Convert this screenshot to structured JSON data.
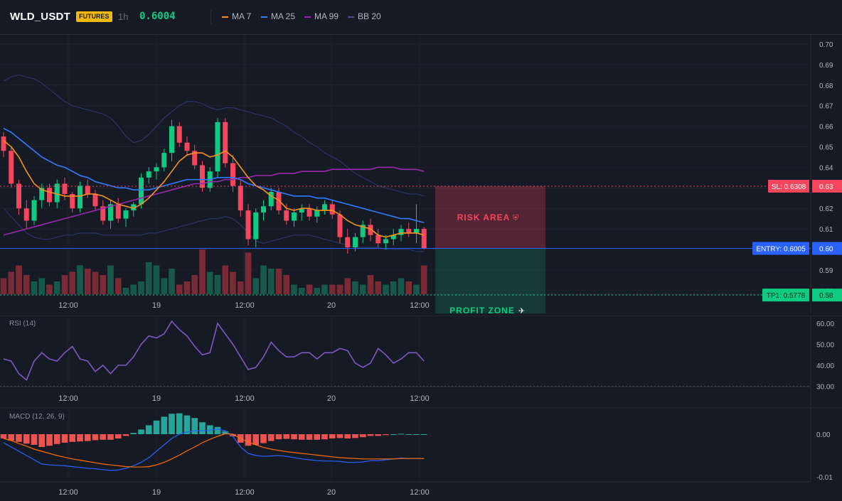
{
  "header": {
    "symbol": "WLD_USDT",
    "badge": "FUTURES",
    "timeframe": "1h",
    "price": "0.6004",
    "legend": [
      {
        "label": "MA 7",
        "color": "#f7931a"
      },
      {
        "label": "MA 25",
        "color": "#2f7dff"
      },
      {
        "label": "MA 99",
        "color": "#9c27b0"
      },
      {
        "label": "BB 20",
        "color": "#3a4f8c"
      }
    ]
  },
  "main_chart": {
    "y_ticks": [
      "0.70",
      "0.69",
      "0.68",
      "0.67",
      "0.66",
      "0.65",
      "0.64",
      "0.63",
      "0.62",
      "0.61",
      "0.60",
      "0.59",
      "0.58"
    ],
    "x_ticks": [
      "12:00",
      "19",
      "12:00",
      "20",
      "12:00"
    ],
    "sl_label": "SL: 0.6308",
    "sl_tag": "0.63",
    "entry_label": "ENTRY: 0.6005",
    "entry_tag": "0.60",
    "tp_label": "TP1: 0.5778",
    "tp_tag": "0.58",
    "risk_text": "RISK AREA",
    "profit_text": "PROFIT ZONE",
    "colors": {
      "up": "#0ecb81",
      "down": "#f6465d",
      "sl": "#f6465d",
      "entry": "#2962ff",
      "tp": "#0ecb81"
    }
  },
  "rsi": {
    "label": "RSI (14)",
    "y_ticks": [
      "60.00",
      "50.00",
      "40.00",
      "30.00"
    ],
    "x_ticks": [
      "12:00",
      "19",
      "12:00",
      "20",
      "12:00"
    ],
    "color": "#7e57c2"
  },
  "macd": {
    "label": "MACD (12, 26, 9)",
    "y_ticks": [
      "0.00",
      "-0.01"
    ],
    "x_ticks": [
      "12:00",
      "19",
      "12:00",
      "20",
      "12:00"
    ]
  },
  "chart_data": {
    "type": "candlestick",
    "interval": "1h",
    "ylim": [
      0.575,
      0.703
    ],
    "candles": [
      [
        0.655,
        0.657,
        0.645,
        0.648
      ],
      [
        0.648,
        0.65,
        0.63,
        0.632
      ],
      [
        0.632,
        0.634,
        0.617,
        0.62
      ],
      [
        0.62,
        0.624,
        0.61,
        0.614
      ],
      [
        0.614,
        0.626,
        0.612,
        0.624
      ],
      [
        0.624,
        0.632,
        0.62,
        0.63
      ],
      [
        0.63,
        0.632,
        0.621,
        0.623
      ],
      [
        0.623,
        0.634,
        0.62,
        0.632
      ],
      [
        0.632,
        0.635,
        0.624,
        0.627
      ],
      [
        0.627,
        0.628,
        0.618,
        0.62
      ],
      [
        0.62,
        0.633,
        0.618,
        0.631
      ],
      [
        0.631,
        0.634,
        0.625,
        0.627
      ],
      [
        0.627,
        0.629,
        0.619,
        0.621
      ],
      [
        0.621,
        0.624,
        0.612,
        0.614
      ],
      [
        0.614,
        0.624,
        0.61,
        0.622
      ],
      [
        0.622,
        0.625,
        0.613,
        0.615
      ],
      [
        0.615,
        0.62,
        0.611,
        0.619
      ],
      [
        0.619,
        0.623,
        0.616,
        0.622
      ],
      [
        0.622,
        0.637,
        0.62,
        0.635
      ],
      [
        0.635,
        0.64,
        0.632,
        0.638
      ],
      [
        0.638,
        0.642,
        0.634,
        0.64
      ],
      [
        0.64,
        0.649,
        0.638,
        0.647
      ],
      [
        0.647,
        0.663,
        0.643,
        0.66
      ],
      [
        0.66,
        0.662,
        0.65,
        0.652
      ],
      [
        0.652,
        0.655,
        0.646,
        0.648
      ],
      [
        0.648,
        0.651,
        0.639,
        0.641
      ],
      [
        0.641,
        0.643,
        0.628,
        0.63
      ],
      [
        0.63,
        0.64,
        0.628,
        0.638
      ],
      [
        0.638,
        0.664,
        0.635,
        0.662
      ],
      [
        0.662,
        0.664,
        0.64,
        0.642
      ],
      [
        0.642,
        0.646,
        0.628,
        0.631
      ],
      [
        0.631,
        0.634,
        0.616,
        0.619
      ],
      [
        0.619,
        0.622,
        0.602,
        0.605
      ],
      [
        0.605,
        0.62,
        0.601,
        0.618
      ],
      [
        0.618,
        0.624,
        0.614,
        0.621
      ],
      [
        0.621,
        0.63,
        0.619,
        0.628
      ],
      [
        0.628,
        0.63,
        0.617,
        0.619
      ],
      [
        0.619,
        0.622,
        0.612,
        0.614
      ],
      [
        0.614,
        0.62,
        0.611,
        0.618
      ],
      [
        0.618,
        0.622,
        0.614,
        0.62
      ],
      [
        0.62,
        0.622,
        0.614,
        0.616
      ],
      [
        0.616,
        0.621,
        0.613,
        0.619
      ],
      [
        0.619,
        0.624,
        0.617,
        0.622
      ],
      [
        0.622,
        0.624,
        0.615,
        0.617
      ],
      [
        0.617,
        0.619,
        0.603,
        0.606
      ],
      [
        0.606,
        0.61,
        0.598,
        0.601
      ],
      [
        0.601,
        0.608,
        0.599,
        0.606
      ],
      [
        0.606,
        0.614,
        0.603,
        0.612
      ],
      [
        0.612,
        0.615,
        0.604,
        0.607
      ],
      [
        0.607,
        0.61,
        0.601,
        0.603
      ],
      [
        0.603,
        0.607,
        0.6,
        0.605
      ],
      [
        0.605,
        0.61,
        0.602,
        0.607
      ],
      [
        0.607,
        0.612,
        0.604,
        0.61
      ],
      [
        0.61,
        0.613,
        0.606,
        0.608
      ],
      [
        0.608,
        0.622,
        0.603,
        0.61
      ],
      [
        0.61,
        0.611,
        0.6,
        0.6004
      ]
    ],
    "ma7": [
      0.653,
      0.65,
      0.645,
      0.638,
      0.632,
      0.629,
      0.628,
      0.627,
      0.626,
      0.626,
      0.626,
      0.627,
      0.627,
      0.626,
      0.624,
      0.622,
      0.621,
      0.62,
      0.622,
      0.625,
      0.629,
      0.633,
      0.638,
      0.643,
      0.646,
      0.647,
      0.647,
      0.645,
      0.646,
      0.648,
      0.645,
      0.64,
      0.635,
      0.631,
      0.629,
      0.626,
      0.624,
      0.62,
      0.619,
      0.62,
      0.62,
      0.619,
      0.619,
      0.619,
      0.617,
      0.614,
      0.612,
      0.611,
      0.61,
      0.607,
      0.606,
      0.607,
      0.608,
      0.608,
      0.608,
      0.607
    ],
    "ma25": [
      0.659,
      0.657,
      0.654,
      0.651,
      0.648,
      0.645,
      0.643,
      0.641,
      0.64,
      0.638,
      0.636,
      0.635,
      0.633,
      0.632,
      0.631,
      0.63,
      0.63,
      0.629,
      0.629,
      0.629,
      0.63,
      0.631,
      0.632,
      0.633,
      0.634,
      0.634,
      0.634,
      0.634,
      0.635,
      0.635,
      0.635,
      0.634,
      0.632,
      0.631,
      0.63,
      0.629,
      0.628,
      0.627,
      0.626,
      0.626,
      0.626,
      0.625,
      0.625,
      0.624,
      0.623,
      0.622,
      0.621,
      0.62,
      0.619,
      0.618,
      0.617,
      0.616,
      0.615,
      0.615,
      0.614,
      0.613
    ],
    "ma99": [
      0.607,
      0.608,
      0.609,
      0.61,
      0.611,
      0.612,
      0.613,
      0.614,
      0.615,
      0.616,
      0.617,
      0.618,
      0.619,
      0.62,
      0.621,
      0.622,
      0.623,
      0.624,
      0.625,
      0.626,
      0.627,
      0.628,
      0.629,
      0.63,
      0.631,
      0.632,
      0.632,
      0.633,
      0.633,
      0.634,
      0.634,
      0.635,
      0.635,
      0.636,
      0.636,
      0.636,
      0.637,
      0.637,
      0.637,
      0.638,
      0.638,
      0.638,
      0.638,
      0.639,
      0.639,
      0.639,
      0.639,
      0.639,
      0.639,
      0.64,
      0.64,
      0.64,
      0.639,
      0.639,
      0.639,
      0.638
    ],
    "bb_upper": [
      0.682,
      0.684,
      0.685,
      0.684,
      0.683,
      0.681,
      0.678,
      0.675,
      0.672,
      0.67,
      0.669,
      0.668,
      0.667,
      0.666,
      0.664,
      0.66,
      0.655,
      0.652,
      0.653,
      0.656,
      0.66,
      0.664,
      0.667,
      0.67,
      0.672,
      0.672,
      0.671,
      0.669,
      0.668,
      0.669,
      0.669,
      0.668,
      0.667,
      0.666,
      0.665,
      0.664,
      0.662,
      0.66,
      0.657,
      0.655,
      0.652,
      0.65,
      0.647,
      0.645,
      0.643,
      0.64,
      0.637,
      0.635,
      0.633,
      0.631,
      0.63,
      0.629,
      0.628,
      0.627,
      0.627,
      0.626
    ],
    "bb_lower": [
      0.62,
      0.616,
      0.612,
      0.608,
      0.606,
      0.605,
      0.605,
      0.606,
      0.607,
      0.607,
      0.608,
      0.608,
      0.608,
      0.607,
      0.607,
      0.607,
      0.607,
      0.607,
      0.607,
      0.608,
      0.608,
      0.609,
      0.61,
      0.611,
      0.612,
      0.613,
      0.614,
      0.615,
      0.615,
      0.616,
      0.615,
      0.612,
      0.608,
      0.604,
      0.603,
      0.604,
      0.605,
      0.606,
      0.607,
      0.607,
      0.607,
      0.606,
      0.605,
      0.604,
      0.603,
      0.602,
      0.601,
      0.601,
      0.601,
      0.601,
      0.6,
      0.6,
      0.6,
      0.6,
      0.599,
      0.599
    ],
    "volumes": [
      0.5,
      0.7,
      0.9,
      0.6,
      0.4,
      0.5,
      0.3,
      0.4,
      0.6,
      0.7,
      0.9,
      0.8,
      0.7,
      0.6,
      0.9,
      0.5,
      0.2,
      0.3,
      0.4,
      1.0,
      0.9,
      0.5,
      0.8,
      0.3,
      0.4,
      0.6,
      1.4,
      0.7,
      0.6,
      0.9,
      0.7,
      0.4,
      1.3,
      0.5,
      0.9,
      0.8,
      0.8,
      0.6,
      0.3,
      0.2,
      0.3,
      0.2,
      0.3,
      0.3,
      0.3,
      0.5,
      0.4,
      0.3,
      0.6,
      0.4,
      0.3,
      0.4,
      0.5,
      0.4,
      0.3,
      0.9
    ],
    "rsi": [
      43,
      42,
      36,
      33,
      42,
      46,
      43,
      42,
      46,
      49,
      43,
      42,
      37,
      40,
      36,
      40,
      40,
      44,
      50,
      54,
      53,
      55,
      61,
      57,
      54,
      49,
      45,
      46,
      60,
      55,
      50,
      44,
      38,
      39,
      44,
      51,
      47,
      44,
      44,
      46,
      46,
      43,
      46,
      46,
      48,
      47,
      41,
      39,
      41,
      48,
      45,
      41,
      43,
      46,
      46,
      42
    ],
    "macd": [
      -0.002,
      -0.003,
      -0.004,
      -0.005,
      -0.006,
      -0.007,
      -0.0072,
      -0.0073,
      -0.0074,
      -0.0076,
      -0.0078,
      -0.008,
      -0.0081,
      -0.0083,
      -0.0085,
      -0.0084,
      -0.008,
      -0.0074,
      -0.0066,
      -0.0055,
      -0.004,
      -0.0025,
      -0.001,
      0.0,
      0.0005,
      0.0008,
      0.0008,
      0.0009,
      0.0012,
      0.0008,
      -0.0005,
      -0.003,
      -0.0045,
      -0.005,
      -0.0052,
      -0.0051,
      -0.005,
      -0.0052,
      -0.0055,
      -0.0058,
      -0.006,
      -0.0062,
      -0.0063,
      -0.0063,
      -0.0064,
      -0.0066,
      -0.0066,
      -0.0065,
      -0.0062,
      -0.0062,
      -0.006,
      -0.0058,
      -0.0056,
      -0.0057,
      -0.0057,
      -0.0057
    ],
    "macd_signal": [
      -0.001,
      -0.0015,
      -0.0022,
      -0.0028,
      -0.0035,
      -0.004,
      -0.0045,
      -0.005,
      -0.0054,
      -0.0058,
      -0.0061,
      -0.0064,
      -0.0067,
      -0.007,
      -0.0072,
      -0.0074,
      -0.0076,
      -0.0077,
      -0.0077,
      -0.0076,
      -0.0072,
      -0.0066,
      -0.0058,
      -0.0049,
      -0.0039,
      -0.003,
      -0.002,
      -0.0012,
      -0.0005,
      0.0001,
      0.0,
      -0.001,
      -0.0018,
      -0.0025,
      -0.0031,
      -0.0035,
      -0.0038,
      -0.0041,
      -0.0043,
      -0.0045,
      -0.0047,
      -0.0049,
      -0.0051,
      -0.0053,
      -0.0055,
      -0.0056,
      -0.0057,
      -0.0058,
      -0.0058,
      -0.0058,
      -0.0058,
      -0.0058,
      -0.0057,
      -0.0057,
      -0.0057,
      -0.0057
    ]
  }
}
